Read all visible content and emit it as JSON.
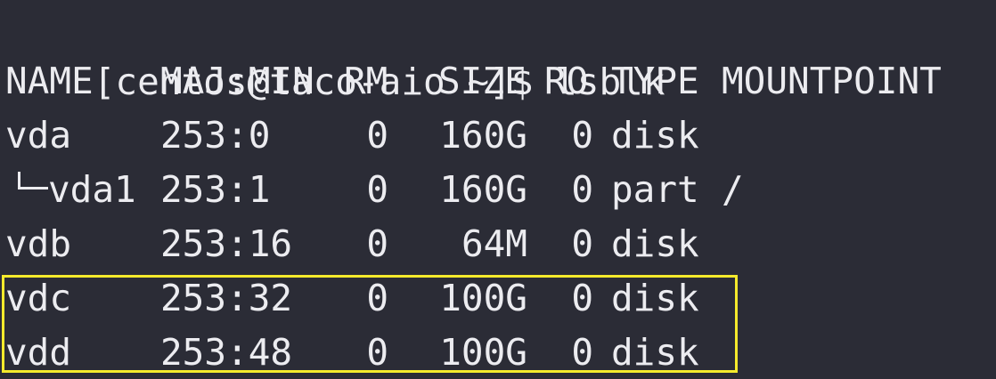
{
  "terminal": {
    "prompt": "[centos@taco-aio ~]$ lsblk",
    "highlight_color": "#f5ea2c",
    "header": {
      "name": "NAME",
      "majmin": "MAJ:MIN",
      "rm": "RM",
      "size": "SIZE",
      "ro": "RO",
      "type": "TYPE",
      "mountpoint": "MOUNTPOINT"
    },
    "rows": [
      {
        "name": "vda",
        "majmin": "253:0",
        "rm": "0",
        "size": "160G",
        "ro": "0",
        "type": "disk",
        "mountpoint": ""
      },
      {
        "name": "vda1",
        "majmin": "253:1",
        "rm": "0",
        "size": "160G",
        "ro": "0",
        "type": "part",
        "mountpoint": "/"
      },
      {
        "name": "vdb",
        "majmin": "253:16",
        "rm": "0",
        "size": "64M",
        "ro": "0",
        "type": "disk",
        "mountpoint": ""
      },
      {
        "name": "vdc",
        "majmin": "253:32",
        "rm": "0",
        "size": "100G",
        "ro": "0",
        "type": "disk",
        "mountpoint": ""
      },
      {
        "name": "vdd",
        "majmin": "253:48",
        "rm": "0",
        "size": "100G",
        "ro": "0",
        "type": "disk",
        "mountpoint": ""
      }
    ]
  }
}
